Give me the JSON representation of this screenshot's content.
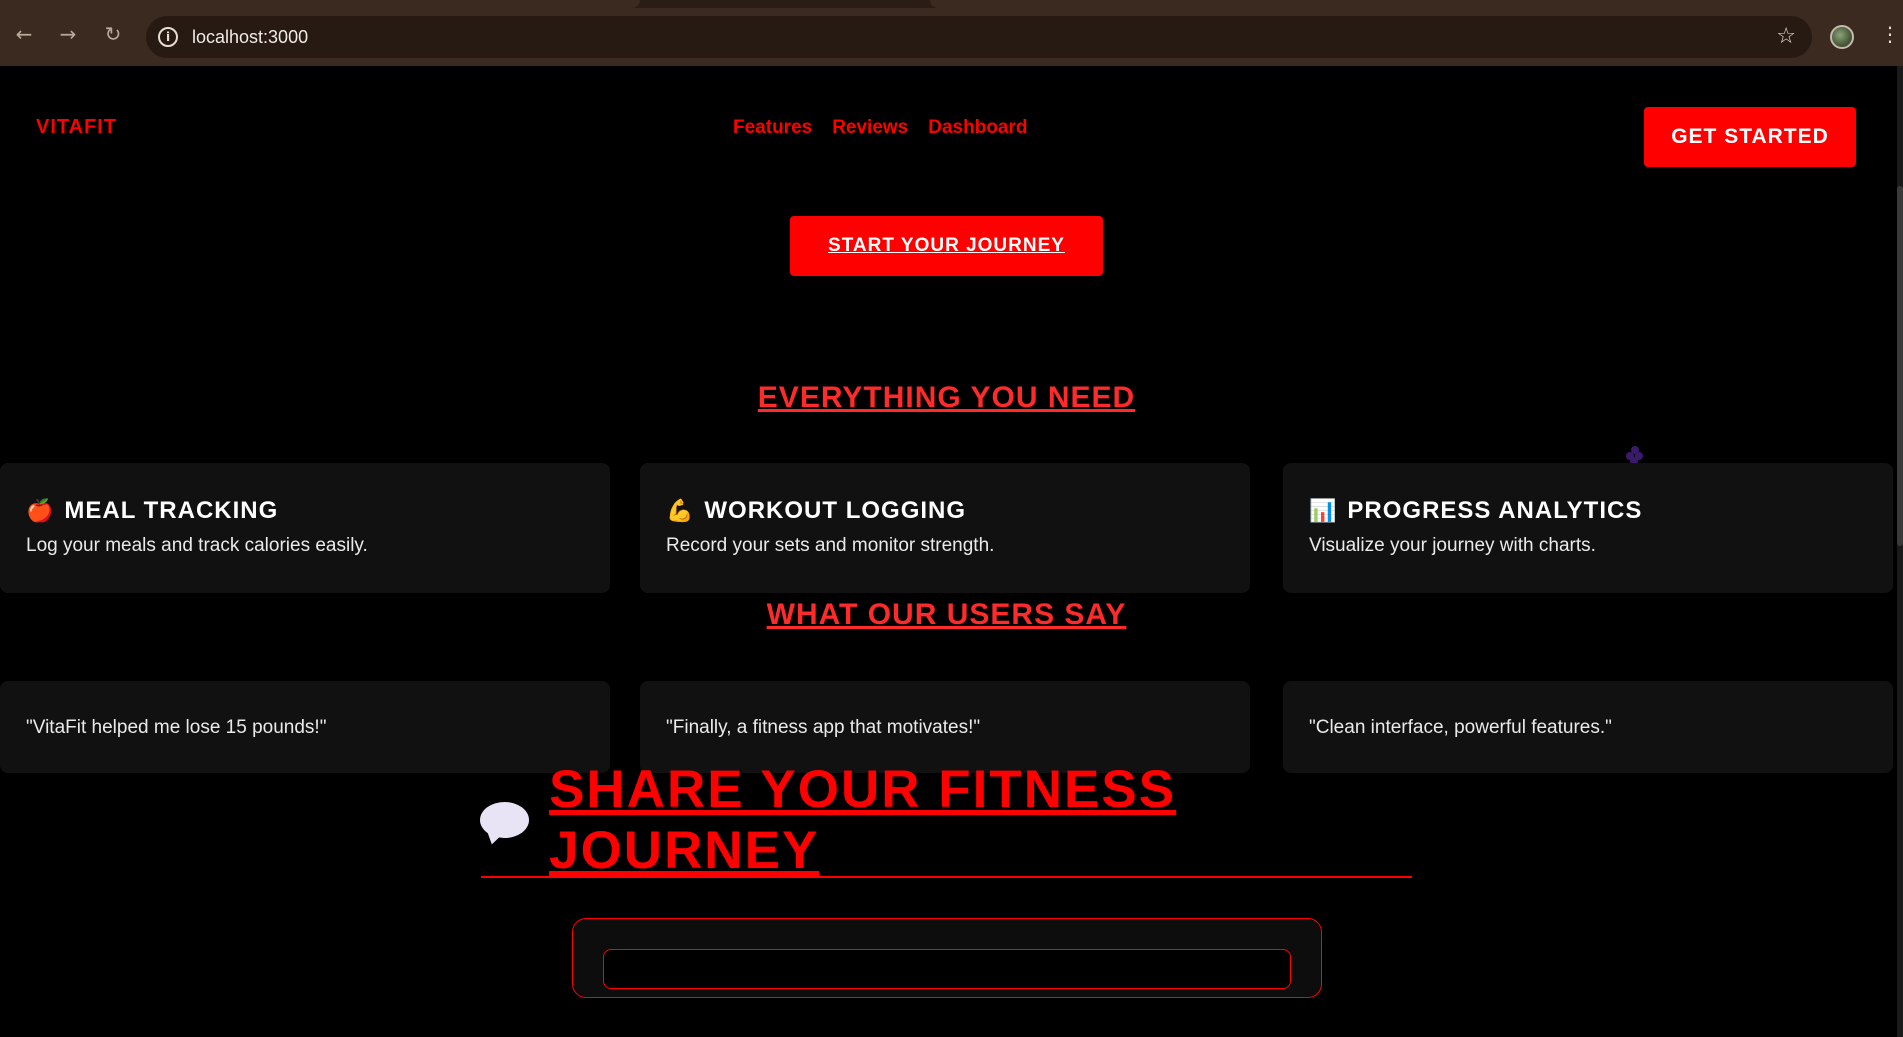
{
  "browser": {
    "url": "localhost:3000"
  },
  "header": {
    "brand": "VITAFIT",
    "nav": [
      "Features",
      "Reviews",
      "Dashboard"
    ],
    "cta": "GET STARTED"
  },
  "hero": {
    "cta": "START YOUR JOURNEY"
  },
  "features": {
    "title": "EVERYTHING YOU NEED",
    "items": [
      {
        "emoji": "🍎",
        "title": "MEAL TRACKING",
        "desc": "Log your meals and track calories easily."
      },
      {
        "emoji": "💪",
        "title": "WORKOUT LOGGING",
        "desc": "Record your sets and monitor strength."
      },
      {
        "emoji": "📊",
        "title": "PROGRESS ANALYTICS",
        "desc": "Visualize your journey with charts."
      }
    ]
  },
  "reviews": {
    "title": "WHAT OUR USERS SAY",
    "items": [
      "\"VitaFit helped me lose 15 pounds!\"",
      "\"Finally, a fitness app that motivates!\"",
      "\"Clean interface, powerful features.\""
    ]
  },
  "share": {
    "title": "SHARE YOUR FITNESS JOURNEY"
  },
  "colors": {
    "accent": "#ff0000",
    "card": "#111111",
    "background": "#000000"
  }
}
